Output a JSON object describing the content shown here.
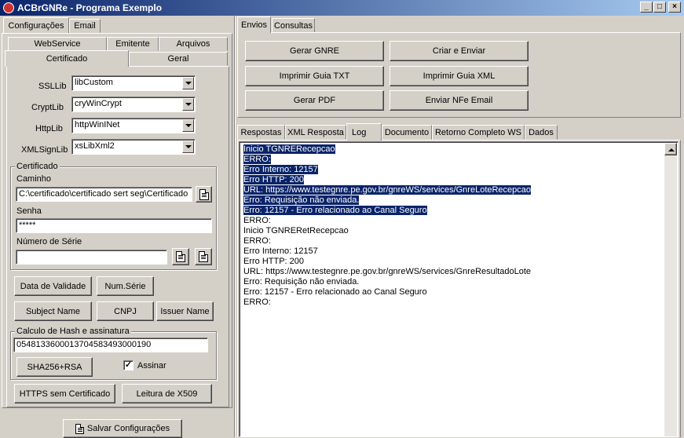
{
  "window": {
    "title": "ACBrGNRe - Programa Exemplo",
    "minimize": "_",
    "maximize": "□",
    "close": "×"
  },
  "left": {
    "top_tabs": [
      "Configurações",
      "Email"
    ],
    "sub_tabs_row1": [
      "WebService",
      "Emitente",
      "Arquivos"
    ],
    "sub_tabs_row2": [
      "Certificado",
      "Geral"
    ],
    "ssllib": {
      "label": "SSLLib",
      "value": "libCustom"
    },
    "cryptlib": {
      "label": "CryptLib",
      "value": "cryWinCrypt"
    },
    "httplib": {
      "label": "HttpLib",
      "value": "httpWinINet"
    },
    "xmlsignlib": {
      "label": "XMLSignLib",
      "value": "xsLibXml2"
    },
    "certificado": {
      "group_title": "Certificado",
      "caminho_label": "Caminho",
      "caminho_value": "C:\\certificado\\certificado sert seg\\Certificado",
      "senha_label": "Senha",
      "senha_value": "*****",
      "numero_serie_label": "Número de Série",
      "numero_serie_value": ""
    },
    "buttons": {
      "data_validade": "Data de Validade",
      "num_serie": "Num.Série",
      "subject_name": "Subject Name",
      "cnpj": "CNPJ",
      "issuer_name": "Issuer Name"
    },
    "hash": {
      "group_title": "Calculo de Hash e assinatura",
      "value": "0548133600013704583493000190",
      "sha_button": "SHA256+RSA",
      "assinar_label": "Assinar",
      "assinar_checked": "✓"
    },
    "https_button": "HTTPS sem Certificado",
    "x509_button": "Leitura de X509",
    "save_button": "Salvar Configurações"
  },
  "right": {
    "top_tabs": [
      "Envios",
      "Consultas"
    ],
    "actions": [
      "Gerar GNRE",
      "Criar e Enviar",
      "Imprimir Guia TXT",
      "Imprimir Guia XML",
      "Gerar PDF",
      "Enviar NFe Email"
    ],
    "result_tabs": [
      "Respostas",
      "XML Resposta",
      "Log",
      "Documento",
      "Retorno Completo WS",
      "Dados"
    ],
    "log_lines": [
      "Inicio TGNRERecepcao",
      "ERRO:",
      "Erro Interno: 12157",
      "Erro HTTP: 200",
      "URL: https://www.testegnre.pe.gov.br/gnreWS/services/GnreLoteRecepcao",
      "Erro: Requisição não enviada.",
      "Erro: 12157 - Erro relacionado ao Canal Seguro",
      "ERRO:",
      "Inicio TGNRERetRecepcao",
      "ERRO:",
      "Erro Interno: 12157",
      "Erro HTTP: 200",
      "URL: https://www.testegnre.pe.gov.br/gnreWS/services/GnreResultadoLote",
      "Erro: Requisição não enviada.",
      "Erro: 12157 - Erro relacionado ao Canal Seguro",
      "ERRO:"
    ]
  }
}
